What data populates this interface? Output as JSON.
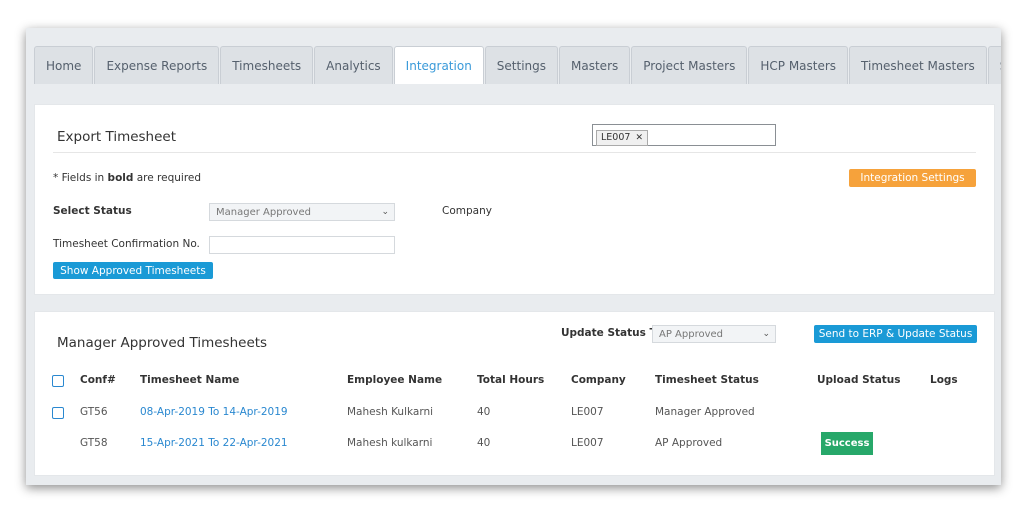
{
  "tabs": [
    {
      "label": "Home",
      "active": false
    },
    {
      "label": "Expense Reports",
      "active": false
    },
    {
      "label": "Timesheets",
      "active": false
    },
    {
      "label": "Analytics",
      "active": false
    },
    {
      "label": "Integration",
      "active": true
    },
    {
      "label": "Settings",
      "active": false
    },
    {
      "label": "Masters",
      "active": false
    },
    {
      "label": "Project Masters",
      "active": false
    },
    {
      "label": "HCP Masters",
      "active": false
    },
    {
      "label": "Timesheet Masters",
      "active": false
    },
    {
      "label": "Support",
      "active": false
    }
  ],
  "export": {
    "title": "Export Timesheet",
    "required_prefix": "* Fields in ",
    "required_bold": "bold",
    "required_suffix": " are required",
    "integration_settings_label": "Integration Settings",
    "select_status_label": "Select Status",
    "select_status_value": "Manager Approved",
    "company_label": "Company",
    "company_tag": "LE007",
    "confirmation_label": "Timesheet Confirmation No.",
    "confirmation_value": "",
    "show_button_label": "Show Approved Timesheets"
  },
  "approved": {
    "title": "Manager Approved Timesheets",
    "update_status_label": "Update Status To",
    "update_status_value": "AP Approved",
    "send_button_label": "Send to ERP & Update Status",
    "columns": {
      "conf": "Conf#",
      "name": "Timesheet Name",
      "employee": "Employee Name",
      "hours": "Total Hours",
      "company": "Company",
      "status": "Timesheet Status",
      "upload": "Upload Status",
      "logs": "Logs"
    },
    "rows": [
      {
        "conf": "GT56",
        "name": "08-Apr-2019 To 14-Apr-2019",
        "employee": "Mahesh Kulkarni",
        "hours": "40",
        "company": "LE007",
        "status": "Manager Approved",
        "upload": "",
        "checkbox": true
      },
      {
        "conf": "GT58",
        "name": "15-Apr-2021 To 22-Apr-2021",
        "employee": "Mahesh kulkarni",
        "hours": "40",
        "company": "LE007",
        "status": "AP Approved",
        "upload": "Success",
        "checkbox": false
      }
    ]
  },
  "colors": {
    "accent_blue": "#1a9ad6",
    "orange": "#f6a23b",
    "success_green": "#27a86a",
    "active_tab_text": "#3a9ad9"
  }
}
